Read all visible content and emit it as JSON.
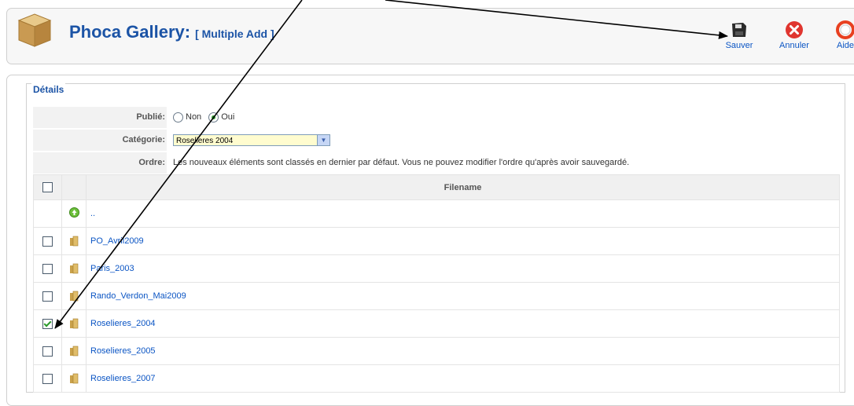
{
  "header": {
    "title": "Phoca Gallery:",
    "subtitle": "[ Multiple Add ]",
    "buttons": [
      {
        "label": "Sauver",
        "icon": "save-icon"
      },
      {
        "label": "Annuler",
        "icon": "cancel-icon"
      },
      {
        "label": "Aide",
        "icon": "help-icon"
      }
    ]
  },
  "details": {
    "legend": "Détails",
    "published": {
      "label": "Publié:",
      "option_no": "Non",
      "option_yes": "Oui",
      "selected": "Oui"
    },
    "category": {
      "label": "Catégorie:",
      "value": "Roselieres 2004"
    },
    "order": {
      "label": "Ordre:",
      "text": "Les nouveaux éléments sont classés en dernier par défaut. Vous ne pouvez modifier l'ordre qu'après avoir sauvegardé."
    }
  },
  "table": {
    "header": "Filename",
    "up_label": "..",
    "rows": [
      {
        "name": "PO_Avril2009",
        "checked": false
      },
      {
        "name": "Paris_2003",
        "checked": false
      },
      {
        "name": "Rando_Verdon_Mai2009",
        "checked": false
      },
      {
        "name": "Roselieres_2004",
        "checked": true
      },
      {
        "name": "Roselieres_2005",
        "checked": false
      },
      {
        "name": "Roselieres_2007",
        "checked": false
      }
    ]
  },
  "colors": {
    "title": "#1c54a6",
    "link": "#0b55c4",
    "cancel": "#e0352f",
    "help": "#e84020"
  }
}
